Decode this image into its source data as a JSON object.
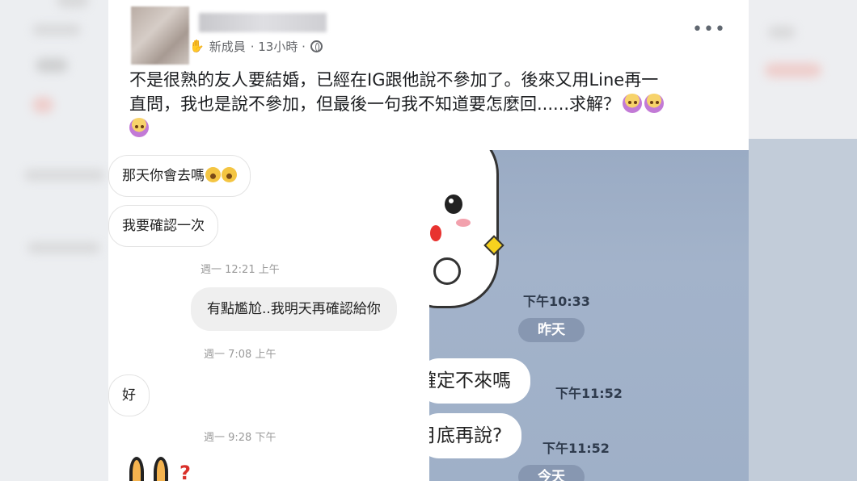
{
  "post": {
    "badge": "新成員",
    "time": "· 13小時 ·",
    "more": "•••",
    "text_line1": "不是很熟的友人要結婚，已經在IG跟他說不參加了。後來又用Line再一",
    "text_line2": "直問，我也是說不參加，但最後一句我不知道要怎麼回......求解？"
  },
  "ig_chat": {
    "msg1": "那天你會去嗎",
    "msg2": "我要確認一次",
    "ts1": "週一 12:21 上午",
    "reply1": "有點尷尬..我明天再確認給你",
    "ts2": "週一 7:08 上午",
    "msg3": "好",
    "ts3": "週一 9:28 下午",
    "q": "?"
  },
  "line_chat": {
    "time1": "下午10:33",
    "day1": "昨天",
    "msg1": "確定不來嗎",
    "time2": "下午11:52",
    "msg2": "月底再說?",
    "time3": "下午11:52",
    "day2": "今天"
  },
  "colors": {
    "line_bg": "#9fb0c8",
    "day_pill": "#8797b1",
    "ig_reply_bubble": "#efefef"
  }
}
